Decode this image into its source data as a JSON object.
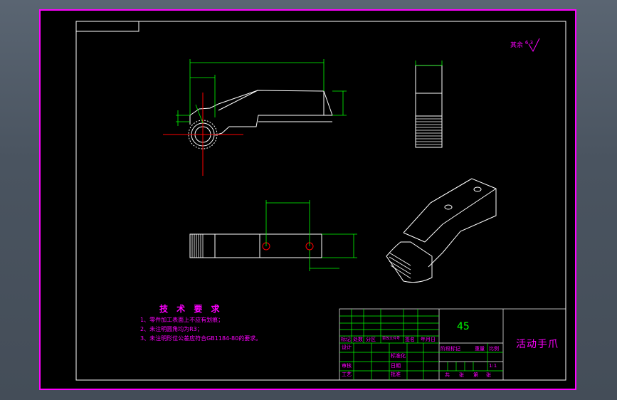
{
  "tech_requirements": {
    "title": "技 术 要 求",
    "items": [
      "1、零件加工表面上不应有划痕；",
      "2、未注明圆角均为R3；",
      "3、未注明形位公差应符合GB1184-80的要求。"
    ]
  },
  "roughness_note": {
    "label": "其余",
    "value": "6.3"
  },
  "title_block": {
    "material": "45",
    "part_name": "活动手爪",
    "header_labels": [
      "标记",
      "处数",
      "分区",
      "更改文件号",
      "签名",
      "年月日"
    ],
    "row_labels": [
      "设计",
      "审核",
      "工艺"
    ],
    "mid_labels": [
      "标准化",
      "日期",
      "批准"
    ],
    "right_header": [
      "阶段标记",
      "重量",
      "比例"
    ],
    "scale": "1:1",
    "sheet_labels": [
      "共",
      "张",
      "第",
      "张"
    ]
  },
  "colors": {
    "frame": "#ff00ff",
    "outline": "#ffffff",
    "dimension": "#00ff00",
    "centerline": "#ff0000",
    "grid": "#00ff00"
  }
}
